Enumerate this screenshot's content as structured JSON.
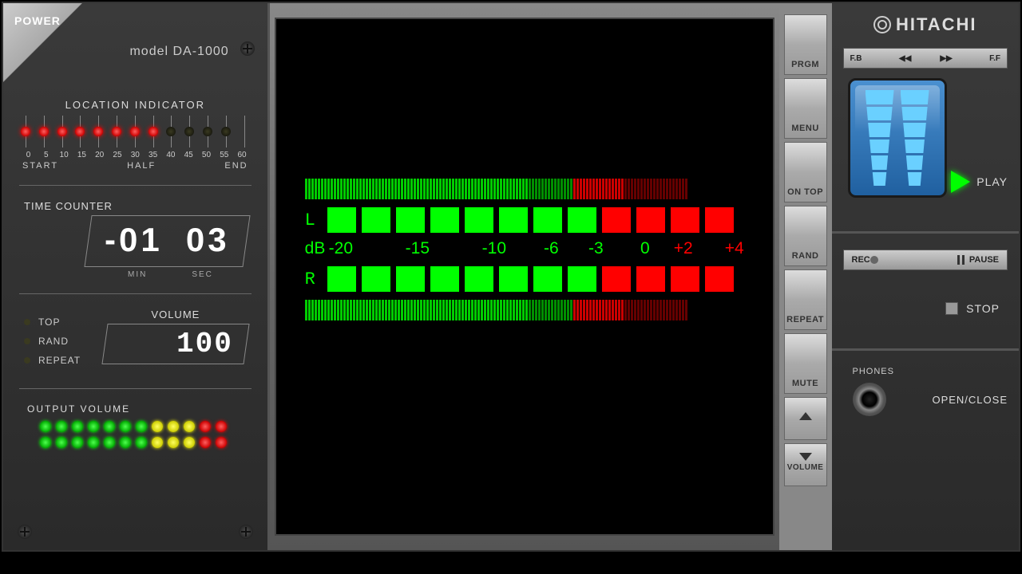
{
  "power_label": "POWER",
  "model": "model  DA-1000",
  "location": {
    "title": "LOCATION INDICATOR",
    "nums": [
      "0",
      "5",
      "10",
      "15",
      "20",
      "25",
      "30",
      "35",
      "40",
      "45",
      "50",
      "55",
      "60"
    ],
    "start": "START",
    "half": "HALF",
    "end": "END",
    "leds_on": 8
  },
  "time_counter": {
    "label": "TIME COUNTER",
    "min": "-01",
    "sec": "03",
    "min_label": "MIN",
    "sec_label": "SEC"
  },
  "flags": {
    "top": "TOP",
    "rand": "RAND",
    "repeat": "REPEAT"
  },
  "volume": {
    "label": "VOLUME",
    "value": "100"
  },
  "output_volume": {
    "label": "OUTPUT VOLUME"
  },
  "meter": {
    "l": "L",
    "r": "R",
    "db": "dB",
    "scale": [
      "-20",
      "-15",
      "-10",
      "-6",
      "-3",
      "0",
      "+2",
      "+4"
    ]
  },
  "buttons": {
    "prgm": "PRGM",
    "menu": "MENU",
    "ontop": "ON TOP",
    "rand": "RAND",
    "repeat": "REPEAT",
    "mute": "MUTE",
    "volume": "VOLUME"
  },
  "brand": "HITACHI",
  "seek": {
    "fb": "F.B",
    "ff": "F.F"
  },
  "play": "PLAY",
  "rec": "REC",
  "pause": "PAUSE",
  "stop": "STOP",
  "phones": "PHONES",
  "openclose": "OPEN/CLOSE"
}
